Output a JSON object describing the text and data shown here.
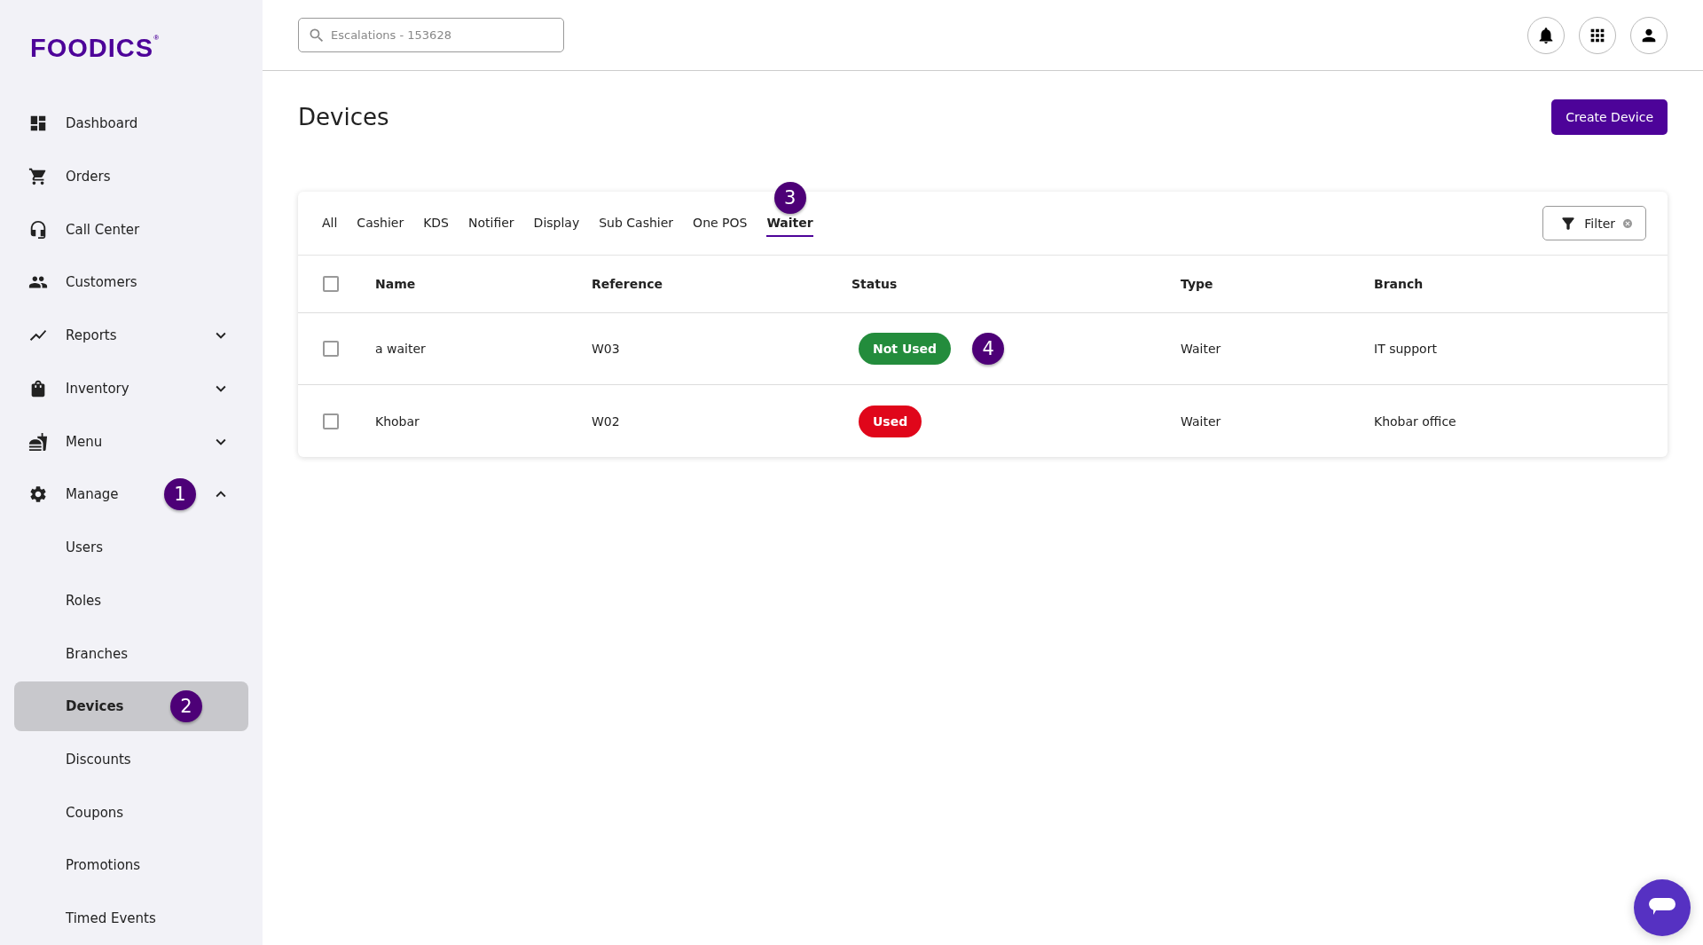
{
  "logo": {
    "text": "FOODICS",
    "mark": "®"
  },
  "sidebar": {
    "items": [
      {
        "label": "Dashboard"
      },
      {
        "label": "Orders"
      },
      {
        "label": "Call Center"
      },
      {
        "label": "Customers"
      },
      {
        "label": "Reports",
        "expanded": false
      },
      {
        "label": "Inventory",
        "expanded": false
      },
      {
        "label": "Menu",
        "expanded": false
      },
      {
        "label": "Manage",
        "expanded": true,
        "callout": "1",
        "children": [
          {
            "label": "Users",
            "selected": false
          },
          {
            "label": "Roles",
            "selected": false
          },
          {
            "label": "Branches",
            "selected": false
          },
          {
            "label": "Devices",
            "selected": true,
            "callout": "2"
          },
          {
            "label": "Discounts",
            "selected": false
          },
          {
            "label": "Coupons",
            "selected": false
          },
          {
            "label": "Promotions",
            "selected": false
          },
          {
            "label": "Timed Events",
            "selected": false
          }
        ]
      }
    ]
  },
  "search": {
    "value": "Escalations - 153628"
  },
  "page_title": "Devices",
  "create_button": "Create Device",
  "tabs": [
    {
      "label": "All",
      "selected": false
    },
    {
      "label": "Cashier",
      "selected": false
    },
    {
      "label": "KDS",
      "selected": false
    },
    {
      "label": "Notifier",
      "selected": false
    },
    {
      "label": "Display",
      "selected": false
    },
    {
      "label": "Sub Cashier",
      "selected": false
    },
    {
      "label": "One POS",
      "selected": false
    },
    {
      "label": "Waiter",
      "selected": true,
      "callout": "3"
    }
  ],
  "filter_button": "Filter",
  "table": {
    "select_all_checked": false,
    "columns": [
      "Name",
      "Reference",
      "Status",
      "Type",
      "Branch"
    ],
    "rows": [
      {
        "checked": false,
        "name": "a waiter",
        "reference": "W03",
        "status": {
          "label": "Not Used",
          "color": "#238c3c"
        },
        "callout": "4",
        "type": "Waiter",
        "branch": "IT support"
      },
      {
        "checked": false,
        "name": "Khobar",
        "reference": "W02",
        "status": {
          "label": "Used",
          "color": "#e0061a"
        },
        "type": "Waiter",
        "branch": "Khobar office"
      }
    ]
  }
}
